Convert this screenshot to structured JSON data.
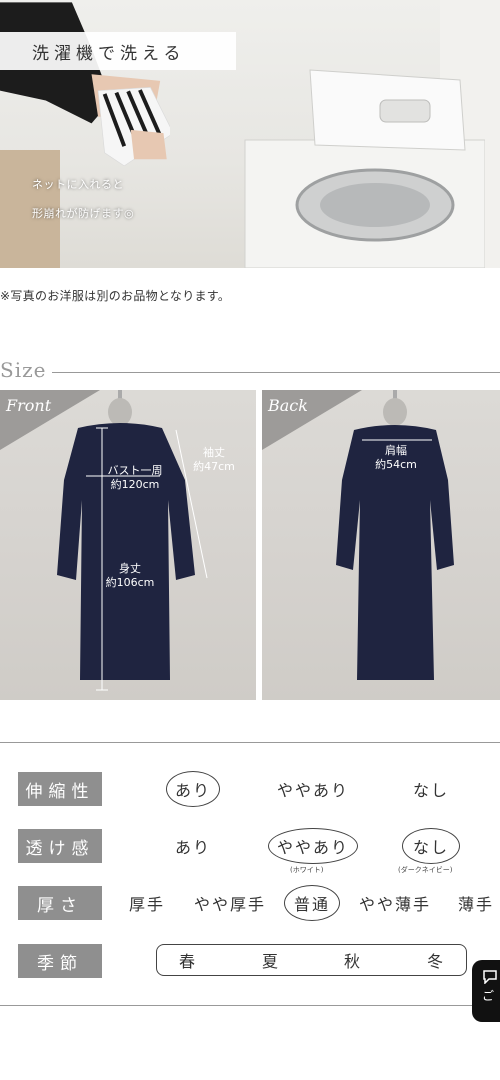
{
  "hero": {
    "title": "洗濯機で洗える",
    "caption_line1": "ネットに入れると",
    "caption_line2": "形崩れが防げます◎"
  },
  "note": "※写真のお洋服は別のお品物となります。",
  "size_section": {
    "heading": "Size",
    "front": {
      "label": "Front",
      "bust_label": "バスト一周",
      "bust_value": "約120cm",
      "sleeve_label": "袖丈",
      "sleeve_value": "約47cm",
      "length_label": "身丈",
      "length_value": "約106cm"
    },
    "back": {
      "label": "Back",
      "shoulder_label": "肩幅",
      "shoulder_value": "約54cm"
    }
  },
  "attributes": {
    "stretch": {
      "label": "伸縮性",
      "options": [
        "あり",
        "ややあり",
        "なし"
      ],
      "selected": "あり"
    },
    "sheerness": {
      "label": "透け感",
      "options": [
        "あり",
        "ややあり",
        "なし"
      ],
      "selected": [
        "ややあり",
        "なし"
      ],
      "sub_notes": [
        "(ホワイト)",
        "(ダークネイビー)"
      ]
    },
    "thickness": {
      "label": "厚さ",
      "options": [
        "厚手",
        "やや厚手",
        "普通",
        "やや薄手",
        "薄手"
      ],
      "selected": "普通"
    },
    "season": {
      "label": "季節",
      "options": [
        "春",
        "夏",
        "秋",
        "冬"
      ]
    }
  },
  "colors": {
    "label_bg": "#8f8f8f",
    "dress_navy": "#1f2440",
    "photo_bg": "#d8d5d1"
  },
  "chat_button": {
    "icon": "chat-icon",
    "text": "ご"
  }
}
